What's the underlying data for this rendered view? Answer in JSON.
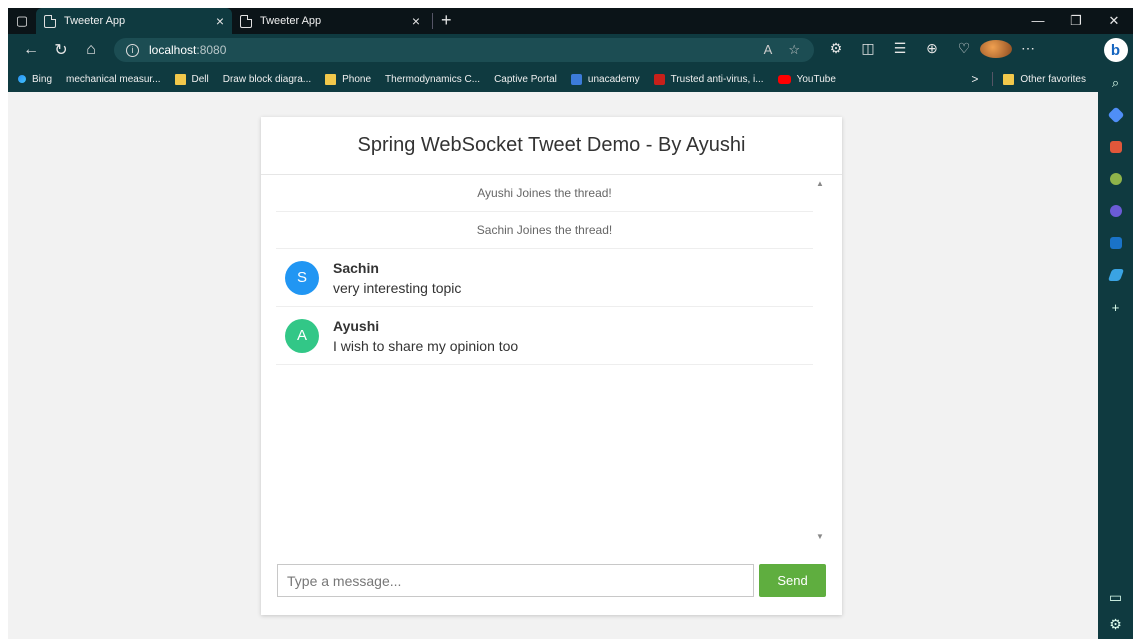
{
  "browser": {
    "tabs": [
      {
        "label": "Tweeter App",
        "active": true
      },
      {
        "label": "Tweeter App",
        "active": false
      }
    ],
    "url": {
      "host": "localhost",
      "port": ":8080"
    },
    "favorites": [
      {
        "label": "Bing",
        "icon": "bing-icon"
      },
      {
        "label": "mechanical measur...",
        "icon": "page-icon"
      },
      {
        "label": "Dell",
        "icon": "folder-icon"
      },
      {
        "label": "Draw block diagra...",
        "icon": "page-icon"
      },
      {
        "label": "Phone",
        "icon": "folder-icon"
      },
      {
        "label": "Thermodynamics C...",
        "icon": "page-icon"
      },
      {
        "label": "Captive Portal",
        "icon": "page-icon"
      },
      {
        "label": "unacademy",
        "icon": "unacademy-icon"
      },
      {
        "label": "Trusted anti-virus, i...",
        "icon": "antivirus-icon"
      },
      {
        "label": "YouTube",
        "icon": "youtube-icon"
      }
    ],
    "other_favorites": "Other favorites"
  },
  "app": {
    "title": "Spring WebSocket Tweet Demo - By Ayushi",
    "events": [
      "Ayushi Joines the thread!",
      "Sachin Joines the thread!"
    ],
    "messages": [
      {
        "initial": "S",
        "name": "Sachin",
        "text": "very interesting topic",
        "color": "#2196f3"
      },
      {
        "initial": "A",
        "name": "Ayushi",
        "text": "I wish to share my opinion too",
        "color": "#32c787"
      }
    ],
    "composer": {
      "placeholder": "Type a message...",
      "send_label": "Send"
    }
  },
  "colors": {
    "chrome": "#0f3a40",
    "send": "#5fae3f",
    "page_bg": "#f2f2f2"
  }
}
